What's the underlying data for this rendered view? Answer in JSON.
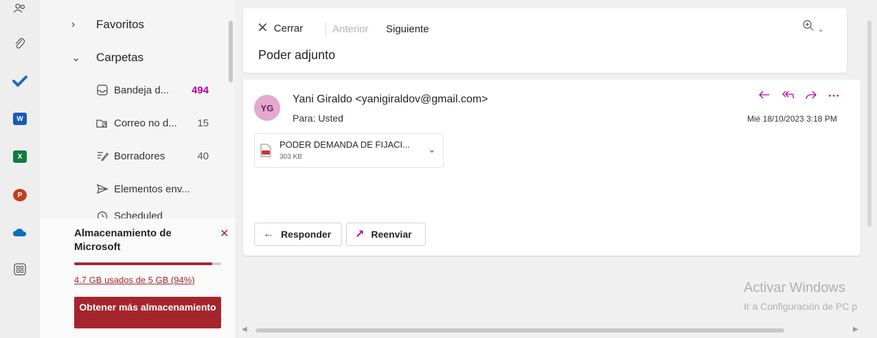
{
  "rail": {
    "apps": [
      {
        "icon": "people-icon"
      },
      {
        "icon": "paperclip-icon"
      },
      {
        "icon": "todo-icon"
      },
      {
        "icon": "word-icon",
        "letter": "W",
        "color": "#185abd"
      },
      {
        "icon": "excel-icon",
        "letter": "X",
        "color": "#107c41"
      },
      {
        "icon": "powerpoint-icon",
        "letter": "P",
        "color": "#c43e1c"
      },
      {
        "icon": "onedrive-icon"
      },
      {
        "icon": "apps-grid-icon"
      }
    ]
  },
  "folders": {
    "favoritos": "Favoritos",
    "carpetas": "Carpetas",
    "items": [
      {
        "label": "Bandeja d...",
        "count": "494",
        "icon": "inbox-icon",
        "unread": true
      },
      {
        "label": "Correo no d...",
        "count": "15",
        "icon": "junk-icon",
        "unread": false
      },
      {
        "label": "Borradores",
        "count": "40",
        "icon": "drafts-icon",
        "unread": false
      },
      {
        "label": "Elementos env...",
        "count": "",
        "icon": "sent-icon",
        "unread": false
      }
    ],
    "partial_label": "Scheduled"
  },
  "storage": {
    "title": "Almacenamiento de Microsoft",
    "usage": "4.7 GB usados de 5 GB (94%)",
    "percent": 94,
    "button": "Obtener más almacenamiento"
  },
  "reading": {
    "close": "Cerrar",
    "prev": "Anterior",
    "next": "Siguiente",
    "subject": "Poder adjunto",
    "message": {
      "avatar": "YG",
      "sender": "Yani Giraldo <yanigiraldov@gmail.com>",
      "to": "Para: Usted",
      "date": "Mié 18/10/2023 3:18 PM",
      "attachment": {
        "name": "PODER DEMANDA DE FIJACI...",
        "size": "303 KB"
      },
      "reply": "Responder",
      "forward": "Reenviar"
    }
  },
  "watermark": {
    "line1": "Activar Windows",
    "line2": "Ir a Configuración de PC p"
  },
  "colors": {
    "accent": "#b4009e",
    "storage": "#a4262c"
  }
}
